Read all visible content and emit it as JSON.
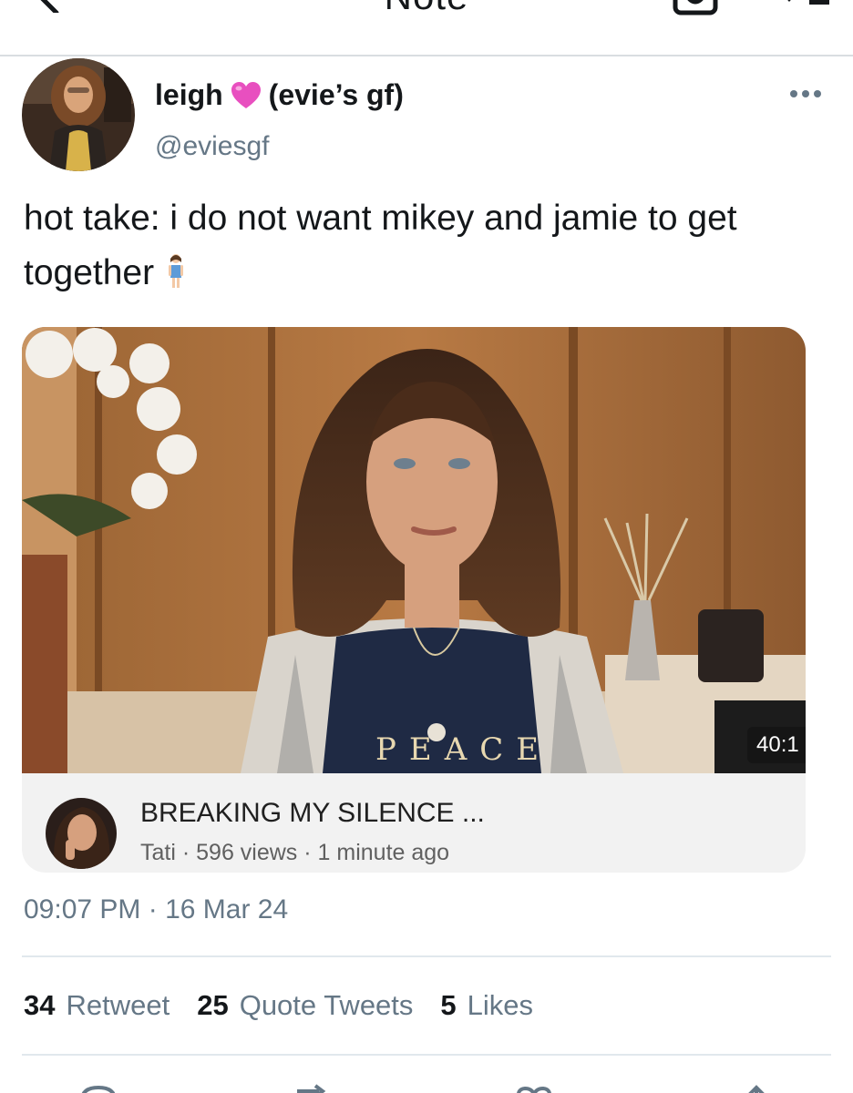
{
  "nav": {
    "title": "Note"
  },
  "tweet": {
    "display_name": "leigh",
    "display_name_suffix": "(evie’s gf)",
    "name_emoji": "pink-heart-icon",
    "handle": "@eviesgf",
    "text": "hot take: i do not want mikey and jamie to get together",
    "text_emoji": "standing-girl-icon",
    "timestamp": "09:07 PM · 16 Mar 24"
  },
  "card": {
    "duration": "40:1",
    "title": "BREAKING MY SILENCE ...",
    "channel": "Tati",
    "views": "596 views",
    "age": "1 minute ago",
    "shirt_text": "PEACE"
  },
  "stats": [
    {
      "count": "34",
      "label": "Retweet"
    },
    {
      "count": "25",
      "label": "Quote Tweets"
    },
    {
      "count": "5",
      "label": "Likes"
    }
  ],
  "colors": {
    "text_primary": "#14171a",
    "text_secondary": "#657786",
    "divider": "#e1e8ed",
    "heart": "#e84fbf"
  }
}
